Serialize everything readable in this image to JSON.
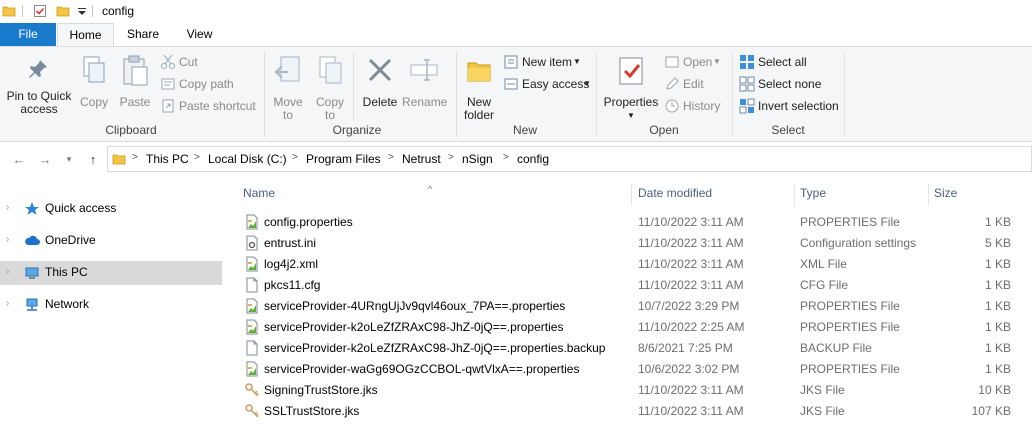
{
  "window": {
    "title": "config"
  },
  "ribbon_tabs": [
    {
      "label": "File"
    },
    {
      "label": "Home"
    },
    {
      "label": "Share"
    },
    {
      "label": "View"
    }
  ],
  "ribbon": {
    "clipboard": {
      "pin_label_1": "Pin to Quick",
      "pin_label_2": "access",
      "copy": "Copy",
      "paste": "Paste",
      "cut": "Cut",
      "copy_path": "Copy path",
      "paste_shortcut": "Paste shortcut",
      "group": "Clipboard"
    },
    "organize": {
      "move_to_1": "Move",
      "move_to_2": "to",
      "copy_to_1": "Copy",
      "copy_to_2": "to",
      "delete": "Delete",
      "rename": "Rename",
      "group": "Organize"
    },
    "new": {
      "new_folder_1": "New",
      "new_folder_2": "folder",
      "new_item": "New item",
      "easy_access": "Easy access",
      "group": "New"
    },
    "open": {
      "properties": "Properties",
      "open": "Open",
      "edit": "Edit",
      "history": "History",
      "group": "Open"
    },
    "select": {
      "select_all": "Select all",
      "select_none": "Select none",
      "invert_selection": "Invert selection",
      "group": "Select"
    }
  },
  "breadcrumbs": [
    "This PC",
    "Local Disk (C:)",
    "Program Files",
    "Netrust",
    "nSign",
    "config"
  ],
  "nav_pane": [
    {
      "label": "Quick access",
      "icon": "star-icon"
    },
    {
      "label": "OneDrive",
      "icon": "cloud-icon"
    },
    {
      "label": "This PC",
      "icon": "computer-icon",
      "selected": true
    },
    {
      "label": "Network",
      "icon": "network-icon"
    }
  ],
  "columns": {
    "name": "Name",
    "date": "Date modified",
    "type": "Type",
    "size": "Size"
  },
  "files": [
    {
      "name": "config.properties",
      "date": "11/10/2022 3:11 AM",
      "type": "PROPERTIES File",
      "size": "1 KB",
      "icon": "properties-file-icon"
    },
    {
      "name": "entrust.ini",
      "date": "11/10/2022 3:11 AM",
      "type": "Configuration settings",
      "size": "5 KB",
      "icon": "settings-file-icon"
    },
    {
      "name": "log4j2.xml",
      "date": "11/10/2022 3:11 AM",
      "type": "XML File",
      "size": "1 KB",
      "icon": "properties-file-icon"
    },
    {
      "name": "pkcs11.cfg",
      "date": "11/10/2022 3:11 AM",
      "type": "CFG File",
      "size": "1 KB",
      "icon": "blank-file-icon"
    },
    {
      "name": "serviceProvider-4URngUjJv9qvl46oux_7PA==.properties",
      "date": "10/7/2022 3:29 PM",
      "type": "PROPERTIES File",
      "size": "1 KB",
      "icon": "properties-file-icon"
    },
    {
      "name": "serviceProvider-k2oLeZfZRAxC98-JhZ-0jQ==.properties",
      "date": "11/10/2022 2:25 AM",
      "type": "PROPERTIES File",
      "size": "1 KB",
      "icon": "properties-file-icon"
    },
    {
      "name": "serviceProvider-k2oLeZfZRAxC98-JhZ-0jQ==.properties.backup",
      "date": "8/6/2021 7:25 PM",
      "type": "BACKUP File",
      "size": "1 KB",
      "icon": "blank-file-icon"
    },
    {
      "name": "serviceProvider-waGg69OGzCCBOL-qwtVlxA==.properties",
      "date": "10/6/2022 3:02 PM",
      "type": "PROPERTIES File",
      "size": "1 KB",
      "icon": "properties-file-icon"
    },
    {
      "name": "SigningTrustStore.jks",
      "date": "11/10/2022 3:11 AM",
      "type": "JKS File",
      "size": "10 KB",
      "icon": "keystore-file-icon"
    },
    {
      "name": "SSLTrustStore.jks",
      "date": "11/10/2022 3:11 AM",
      "type": "JKS File",
      "size": "107 KB",
      "icon": "keystore-file-icon"
    }
  ],
  "colors": {
    "file_tab": "#1979ca",
    "folder": "#f4c542",
    "selected_nav": "#d9d9d9"
  }
}
